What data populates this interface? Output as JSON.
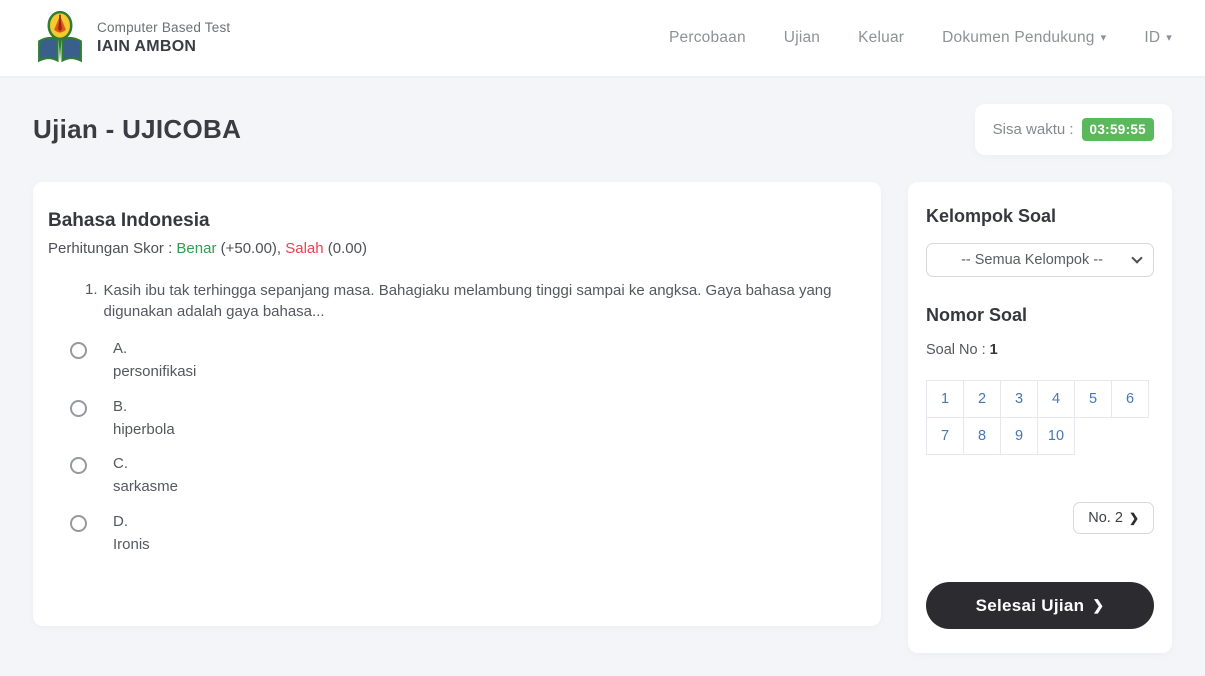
{
  "navbar": {
    "brand": {
      "subtitle": "Computer Based Test",
      "title": "IAIN AMBON",
      "logo_icon": "iain-ambon-emblem"
    },
    "items": [
      {
        "label": "Percobaan",
        "dropdown": false
      },
      {
        "label": "Ujian",
        "dropdown": false
      },
      {
        "label": "Keluar",
        "dropdown": false
      },
      {
        "label": "Dokumen Pendukung",
        "dropdown": true
      },
      {
        "label": "ID",
        "dropdown": true
      }
    ]
  },
  "page": {
    "title": "Ujian - UJICOBA",
    "timer_label": "Sisa waktu :",
    "timer_value": "03:59:55"
  },
  "exam": {
    "subject": "Bahasa Indonesia",
    "score_prefix": "Perhitungan Skor : ",
    "score_benar_label": "Benar",
    "score_benar_suffix": " (+50.00), ",
    "score_salah_label": "Salah",
    "score_salah_suffix": " (0.00)",
    "question_number": "1.",
    "question_text": "Kasih ibu tak terhingga sepanjang masa. Bahagiaku melambung tinggi sampai ke angksa. Gaya bahasa yang digunakan adalah gaya bahasa...",
    "options": [
      {
        "letter": "A.",
        "text": "personifikasi"
      },
      {
        "letter": "B.",
        "text": "hiperbola"
      },
      {
        "letter": "C.",
        "text": "sarkasme"
      },
      {
        "letter": "D.",
        "text": "Ironis"
      }
    ]
  },
  "sidebar": {
    "group_title": "Kelompok Soal",
    "group_select_value": "-- Semua Kelompok --",
    "numbers_title": "Nomor Soal",
    "current_label": "Soal No : ",
    "current_value": "1",
    "numbers": [
      "1",
      "2",
      "3",
      "4",
      "5",
      "6",
      "7",
      "8",
      "9",
      "10"
    ],
    "next_button_label": "No. 2",
    "next_button_icon": "chevron-right",
    "finish_button_label": "Selesai Ujian",
    "finish_button_icon": "chevron-right"
  },
  "colors": {
    "page_background": "#f4f5f9",
    "timer_badge_green": "#5cb85c",
    "benar_green": "#2e9e4f",
    "salah_red": "#ef3e4e",
    "number_link_blue": "#4678b2",
    "finish_button_dark": "#2b2b30"
  }
}
